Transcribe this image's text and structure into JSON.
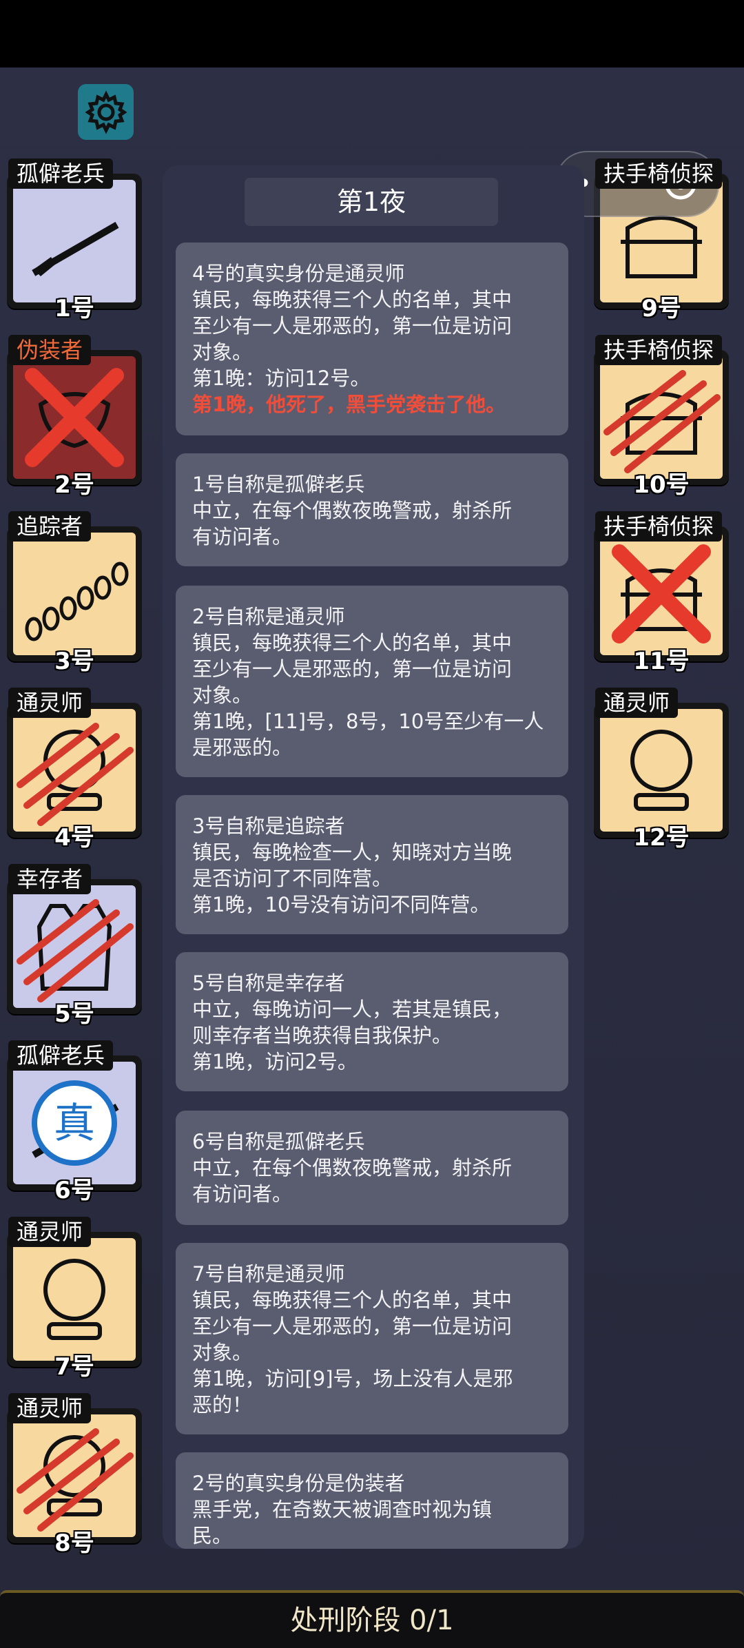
{
  "log_title": "第1夜",
  "players_left": [
    {
      "role": "孤僻老兵",
      "number": "1号",
      "icon": "rifle-icon"
    },
    {
      "role": "伪装者",
      "number": "2号",
      "icon": "mask-icon"
    },
    {
      "role": "追踪者",
      "number": "3号",
      "icon": "footprints-icon"
    },
    {
      "role": "通灵师",
      "number": "4号",
      "icon": "crystal-ball-icon"
    },
    {
      "role": "幸存者",
      "number": "5号",
      "icon": "vest-icon"
    },
    {
      "role": "孤僻老兵",
      "number": "6号",
      "icon": "rifle-icon",
      "stamp": "真"
    },
    {
      "role": "通灵师",
      "number": "7号",
      "icon": "crystal-ball-icon"
    },
    {
      "role": "通灵师",
      "number": "8号",
      "icon": "crystal-ball-icon"
    }
  ],
  "players_right": [
    {
      "role": "扶手椅侦探",
      "number": "9号",
      "icon": "armchair-icon"
    },
    {
      "role": "扶手椅侦探",
      "number": "10号",
      "icon": "armchair-icon"
    },
    {
      "role": "扶手椅侦探",
      "number": "11号",
      "icon": "armchair-icon"
    },
    {
      "role": "通灵师",
      "number": "12号",
      "icon": "crystal-ball-icon"
    }
  ],
  "log_entries": [
    {
      "lines": [
        "4号的真实身份是通灵师",
        "镇民，每晚获得三个人的名单，其中",
        "至少有一人是邪恶的，第一位是访问",
        "对象。",
        "第1晚：访问12号。"
      ],
      "highlight": "第1晚，他死了，黑手党袭击了他。"
    },
    {
      "lines": [
        "1号自称是孤僻老兵",
        "中立，在每个偶数夜晚警戒，射杀所",
        "有访问者。"
      ]
    },
    {
      "lines": [
        "2号自称是通灵师",
        "镇民，每晚获得三个人的名单，其中",
        "至少有一人是邪恶的，第一位是访问",
        "对象。",
        "第1晚，[11]号，8号，10号至少有一人",
        "是邪恶的。"
      ]
    },
    {
      "lines": [
        "3号自称是追踪者",
        "镇民，每晚检查一人，知晓对方当晚",
        "是否访问了不同阵营。",
        "第1晚，10号没有访问不同阵营。"
      ]
    },
    {
      "lines": [
        "5号自称是幸存者",
        "中立，每晚访问一人，若其是镇民，",
        "则幸存者当晚获得自我保护。",
        "第1晚，访问2号。"
      ]
    },
    {
      "lines": [
        "6号自称是孤僻老兵",
        "中立，在每个偶数夜晚警戒，射杀所",
        "有访问者。"
      ]
    },
    {
      "lines": [
        "7号自称是通灵师",
        "镇民，每晚获得三个人的名单，其中",
        "至少有一人是邪恶的，第一位是访问",
        "对象。",
        "第1晚，访问[9]号，场上没有人是邪",
        "恶的！"
      ]
    },
    {
      "lines": [
        "2号的真实身份是伪装者",
        "黑手党，在奇数天被调查时视为镇",
        "民。"
      ]
    }
  ],
  "bottom_bar": {
    "label": "处刑阶段 0/1"
  },
  "colors": {
    "accent_red": "#f04e3a",
    "settings_teal": "#1f7a8c",
    "card_blue": "#c9c9ea",
    "card_peach": "#f7d9a0"
  }
}
